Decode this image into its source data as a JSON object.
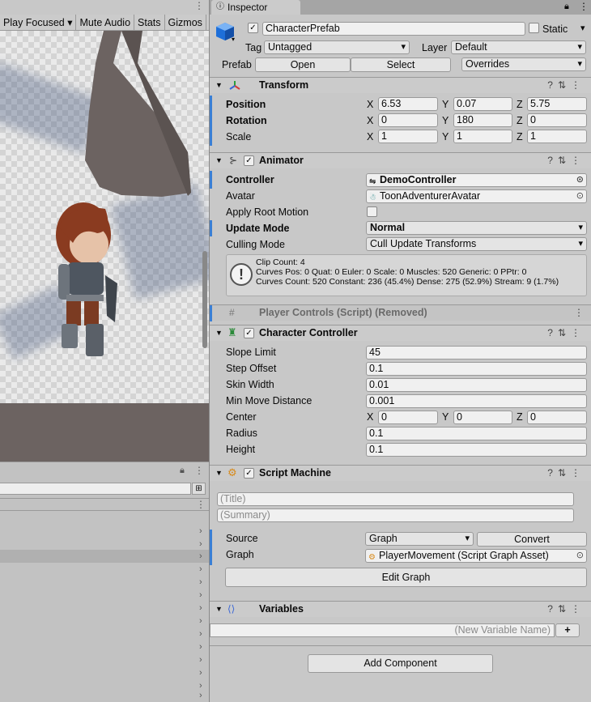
{
  "game_toolbar": {
    "items": [
      "Play Focused",
      "Mute Audio",
      "Stats",
      "Gizmos"
    ]
  },
  "inspector": {
    "tab": "Inspector",
    "object": {
      "name": "CharacterPrefab",
      "static_label": "Static",
      "tag_label": "Tag",
      "tag_value": "Untagged",
      "layer_label": "Layer",
      "layer_value": "Default",
      "prefab_label": "Prefab",
      "open": "Open",
      "select": "Select",
      "overrides": "Overrides"
    },
    "transform": {
      "title": "Transform",
      "position_label": "Position",
      "rotation_label": "Rotation",
      "scale_label": "Scale",
      "position": {
        "x": "6.53",
        "y": "0.07",
        "z": "5.75"
      },
      "rotation": {
        "x": "0",
        "y": "180",
        "z": "0"
      },
      "scale": {
        "x": "1",
        "y": "1",
        "z": "1"
      },
      "axis": {
        "x": "X",
        "y": "Y",
        "z": "Z"
      }
    },
    "animator": {
      "title": "Animator",
      "controller_label": "Controller",
      "controller": "DemoController",
      "avatar_label": "Avatar",
      "avatar": "ToonAdventurerAvatar",
      "root_motion_label": "Apply Root Motion",
      "update_mode_label": "Update Mode",
      "update_mode": "Normal",
      "culling_label": "Culling Mode",
      "culling": "Cull Update Transforms",
      "info": [
        "Clip Count: 4",
        "Curves Pos: 0 Quat: 0 Euler: 0 Scale: 0 Muscles: 520 Generic: 0 PPtr: 0",
        "Curves Count: 520 Constant: 236 (45.4%) Dense: 275 (52.9%) Stream: 9 (1.7%)"
      ],
      "info_icon": "!"
    },
    "removed": {
      "title": "Player Controls (Script) (Removed)"
    },
    "character_controller": {
      "title": "Character Controller",
      "slope_label": "Slope Limit",
      "slope": "45",
      "step_label": "Step Offset",
      "step": "0.1",
      "skin_label": "Skin Width",
      "skin": "0.01",
      "minmove_label": "Min Move Distance",
      "minmove": "0.001",
      "center_label": "Center",
      "center": {
        "x": "0",
        "y": "0",
        "z": "0"
      },
      "radius_label": "Radius",
      "radius": "0.1",
      "height_label": "Height",
      "height": "0.1"
    },
    "script_machine": {
      "title": "Script Machine",
      "title_placeholder": "(Title)",
      "summary_placeholder": "(Summary)",
      "source_label": "Source",
      "source": "Graph",
      "convert": "Convert",
      "graph_label": "Graph",
      "graph": "PlayerMovement (Script Graph Asset)",
      "edit_graph": "Edit Graph"
    },
    "variables": {
      "title": "Variables",
      "new_var_placeholder": "(New Variable Name)",
      "add": "+"
    },
    "add_component": "Add Component"
  }
}
